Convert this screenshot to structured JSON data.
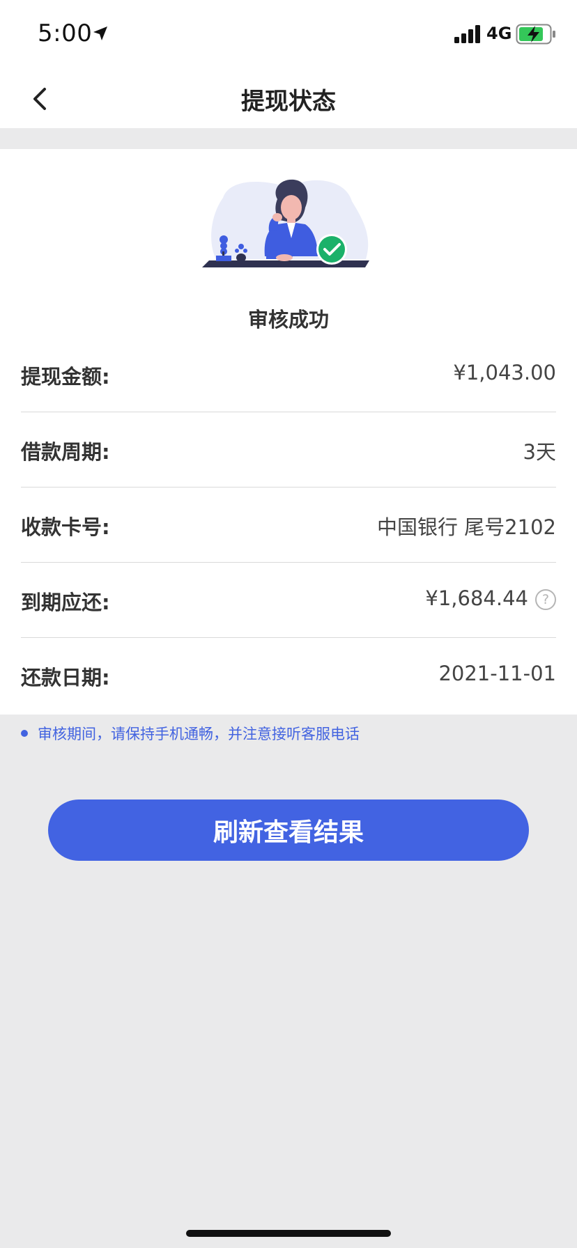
{
  "status_bar": {
    "time": "5:00",
    "network": "4G"
  },
  "nav": {
    "title": "提现状态"
  },
  "status": {
    "title": "审核成功"
  },
  "details": [
    {
      "label": "提现金额:",
      "value": "¥1,043.00"
    },
    {
      "label": "借款周期:",
      "value": "3天"
    },
    {
      "label": "收款卡号:",
      "value": "中国银行 尾号2102"
    },
    {
      "label": "到期应还:",
      "value": "¥1,684.44"
    },
    {
      "label": "还款日期:",
      "value": "2021-11-01"
    }
  ],
  "help_icon": "?",
  "notice": "审核期间，请保持手机通畅，并注意接听客服电话",
  "button": {
    "label": "刷新查看结果"
  },
  "colors": {
    "accent": "#4263e2",
    "success": "#1bb16a",
    "background": "#eaeaeb"
  }
}
